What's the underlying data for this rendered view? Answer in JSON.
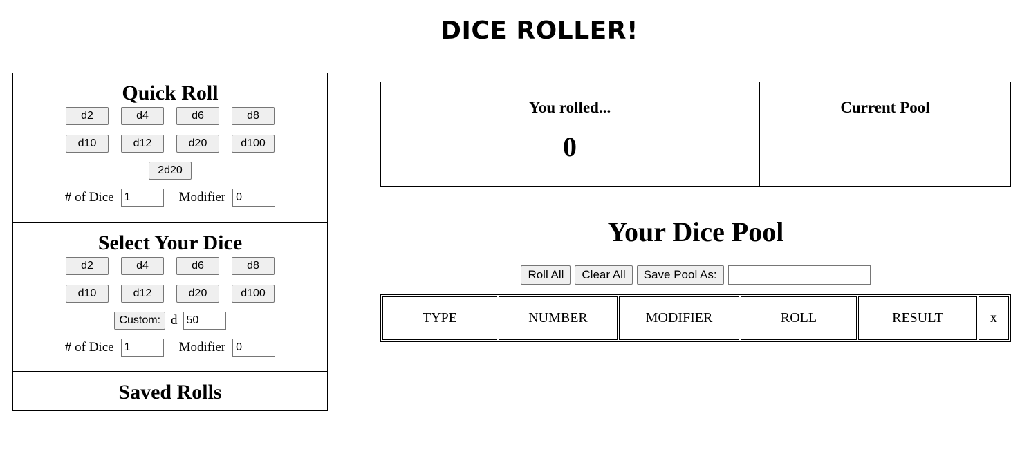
{
  "app": {
    "title": "DICE ROLLER!"
  },
  "quick_roll": {
    "title": "Quick Roll",
    "dice": [
      "d2",
      "d4",
      "d6",
      "d8",
      "d10",
      "d12",
      "d20",
      "d100"
    ],
    "extra_button": "2d20",
    "num_dice_label": "# of Dice",
    "num_dice_value": "1",
    "modifier_label": "Modifier",
    "modifier_value": "0"
  },
  "select_dice": {
    "title": "Select Your Dice",
    "dice": [
      "d2",
      "d4",
      "d6",
      "d8",
      "d10",
      "d12",
      "d20",
      "d100"
    ],
    "custom_button": "Custom:",
    "custom_prefix": "d",
    "custom_value": "50",
    "num_dice_label": "# of Dice",
    "num_dice_value": "1",
    "modifier_label": "Modifier",
    "modifier_value": "0"
  },
  "saved_rolls": {
    "title": "Saved Rolls"
  },
  "result": {
    "rolled_label": "You rolled...",
    "rolled_value": "0",
    "current_pool_label": "Current Pool"
  },
  "pool": {
    "title": "Your Dice Pool",
    "roll_all": "Roll All",
    "clear_all": "Clear All",
    "save_as": "Save Pool As:",
    "save_name_value": "",
    "columns": [
      "TYPE",
      "NUMBER",
      "MODIFIER",
      "ROLL",
      "RESULT",
      "x"
    ]
  }
}
